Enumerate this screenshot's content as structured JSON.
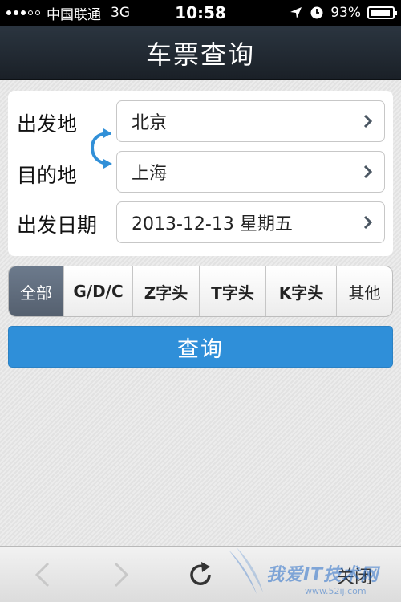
{
  "status_bar": {
    "carrier": "中国联通",
    "network": "3G",
    "time": "10:58",
    "battery": "93%",
    "battery_level": 0.93
  },
  "header": {
    "title": "车票查询"
  },
  "form": {
    "from_label": "出发地",
    "from_value": "北京",
    "to_label": "目的地",
    "to_value": "上海",
    "date_label": "出发日期",
    "date_value": "2013-12-13 星期五"
  },
  "train_types": {
    "options": [
      "全部",
      "G/D/C",
      "Z字头",
      "T字头",
      "K字头",
      "其他"
    ],
    "selected": "全部"
  },
  "query_button": {
    "label": "查询"
  },
  "toolbar": {
    "close_label": "关闭"
  },
  "watermark": {
    "text": "我爱IT技术网",
    "url": "www.52ij.com"
  },
  "colors": {
    "accent": "#2f8fd9",
    "header_bg": "#1f262e",
    "segment_active": "#5f6c7c"
  }
}
